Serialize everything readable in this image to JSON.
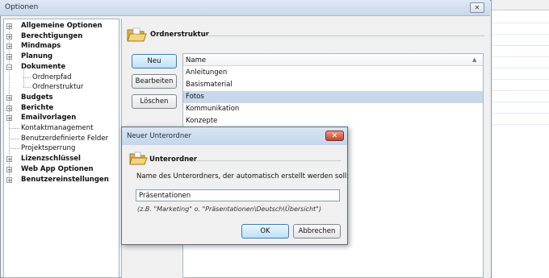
{
  "window": {
    "title": "Optionen",
    "close_glyph": "✕"
  },
  "tree": {
    "items": [
      {
        "label": "Allgemeine Optionen",
        "bold": true,
        "expander": "+"
      },
      {
        "label": "Berechtigungen",
        "bold": true,
        "expander": "+"
      },
      {
        "label": "Mindmaps",
        "bold": true,
        "expander": "+"
      },
      {
        "label": "Planung",
        "bold": true,
        "expander": "+"
      },
      {
        "label": "Dokumente",
        "bold": true,
        "expander": "−"
      },
      {
        "label": "Ordnerpfad",
        "bold": false,
        "child": true
      },
      {
        "label": "Ordnerstruktur",
        "bold": false,
        "child": true
      },
      {
        "label": "Budgets",
        "bold": true,
        "expander": "+"
      },
      {
        "label": "Berichte",
        "bold": true,
        "expander": "+"
      },
      {
        "label": "Emailvorlagen",
        "bold": true,
        "expander": "+"
      },
      {
        "label": "Kontaktmanagement",
        "bold": false
      },
      {
        "label": "Benutzerdefinierte Felder",
        "bold": false
      },
      {
        "label": "Projektsperrung",
        "bold": false
      },
      {
        "label": "Lizenzschlüssel",
        "bold": true,
        "expander": "+"
      },
      {
        "label": "Web App Optionen",
        "bold": true,
        "expander": "+"
      },
      {
        "label": "Benutzereinstellungen",
        "bold": true,
        "expander": "+"
      }
    ]
  },
  "content": {
    "section_title": "Ordnerstruktur",
    "section_icon": "folder-icon",
    "buttons": {
      "new": "Neu",
      "edit": "Bearbeiten",
      "delete": "Löschen"
    },
    "list": {
      "header": "Name",
      "sort_glyph": "▲",
      "rows": [
        "Anleitungen",
        "Basismaterial",
        "Fotos",
        "Kommunikation",
        "Konzepte"
      ],
      "selected": "Fotos"
    }
  },
  "dialog": {
    "title": "Neuer Unterordner",
    "close_glyph": "✕",
    "section_title": "Unterordner",
    "section_icon": "folder-icon",
    "prompt": "Name des Unterordners, der automatisch erstellt werden soll:",
    "input_value": "Präsentationen",
    "hint": "(z.B. \"Marketing\" o. \"Präsentationen\\Deutsch\\Übersicht\")",
    "ok_label": "OK",
    "cancel_label": "Abbrechen"
  },
  "colors": {
    "selection": "#c8d7ea",
    "close_button_red": "#c8402a",
    "default_button_blue": "#bfe0f5"
  }
}
